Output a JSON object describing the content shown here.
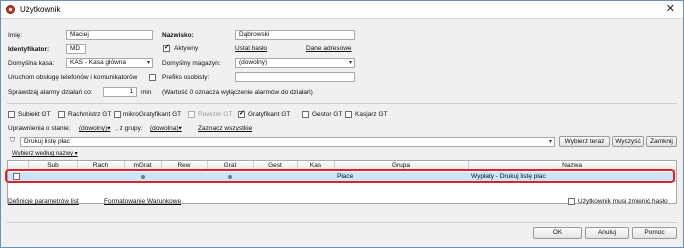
{
  "window": {
    "title": "Użytkownik",
    "close_glyph": "✕"
  },
  "form": {
    "first_name_label": "Imię:",
    "first_name_value": "Maciej",
    "last_name_label": "Nazwisko:",
    "last_name_value": "Dąbrowski",
    "identifier_label": "Identyfikator:",
    "identifier_value": "MD",
    "active_label": "Aktywny",
    "active_checked": true,
    "password_link": "Ustal hasło",
    "address_link": "Dane adresowe",
    "default_cash_label": "Domyślna kasa:",
    "default_cash_value": "KAS - Kasa główna",
    "default_warehouse_label": "Domyślny magazyn:",
    "default_warehouse_value": "(dowolny)",
    "phone_service_label": "Uruchom obsługę telefonów i komunikatorów",
    "prefix_label": "Prefiks osobisty:",
    "prefix_value": "",
    "alarm_label": "Sprawdzaj alarmy działań co:",
    "alarm_value": "1",
    "alarm_unit": "min",
    "alarm_note": "(Wartość 0 oznacza wyłączenie alarmów do działań)"
  },
  "roles": [
    {
      "label": "Subiekt GT",
      "checked": false,
      "disabled": false
    },
    {
      "label": "Rachmistrz GT",
      "checked": false,
      "disabled": false
    },
    {
      "label": "mikroGratyfikant GT",
      "checked": false,
      "disabled": false
    },
    {
      "label": "Rewizor GT",
      "checked": false,
      "disabled": true
    },
    {
      "label": "Gratyfikant GT",
      "checked": true,
      "disabled": false
    },
    {
      "label": "Gestor GT",
      "checked": false,
      "disabled": false
    },
    {
      "label": "Kasjarz GT",
      "checked": false,
      "disabled": false
    }
  ],
  "permissions": {
    "state_label": "Uprawnienia o stanie:",
    "state_value": "(dowolny)",
    "group_label": ", z grupy:",
    "group_value": "(dowolna)",
    "select_all_link": "Zaznacz wszystkie",
    "search_value": "Drukuj listę płac",
    "choose_button": "Wybierz teraz",
    "clear_button": "Wyczyść",
    "close_button": "Zamknij",
    "sort_label": "Wybierz według nazwy",
    "dropdown_glyph": "▾"
  },
  "grid": {
    "columns": [
      "Sub",
      "Rach",
      "mGrat",
      "Rew",
      "Grat",
      "Gest",
      "Kas",
      "Grupa",
      "Nazwa"
    ],
    "row": {
      "group": "Płace",
      "name": "Wypłaty - Drukuj listę płac"
    }
  },
  "footer": {
    "params_link": "Definicje parametrów list",
    "format_link": "Formatowanie Warunkowe",
    "must_change_label": "Użytkownik musi zmienić hasło",
    "ok_button": "OK",
    "cancel_button": "Anuluj",
    "help_button": "Pomoc"
  },
  "colors": {
    "selected_row": "#cde4f9",
    "highlight_frame": "#d9232e",
    "frame": "#6b8fb8"
  }
}
